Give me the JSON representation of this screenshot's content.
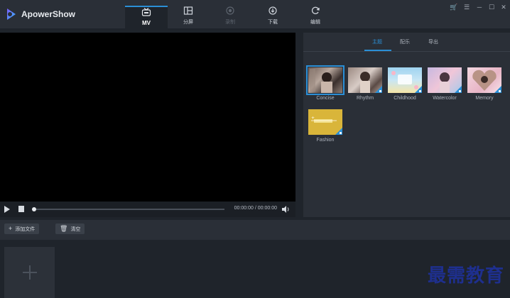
{
  "app": {
    "name": "ApowerShow"
  },
  "nav": [
    {
      "label": "MV",
      "icon": "mv-tv-icon",
      "state": "active"
    },
    {
      "label": "分屏",
      "icon": "split-screen-icon",
      "state": "normal"
    },
    {
      "label": "录制",
      "icon": "record-icon",
      "state": "disabled"
    },
    {
      "label": "下载",
      "icon": "download-icon",
      "state": "normal"
    },
    {
      "label": "编辑",
      "icon": "edit-refresh-icon",
      "state": "normal"
    }
  ],
  "window_controls": [
    "cart-icon",
    "menu-icon",
    "minimize-icon",
    "maximize-icon",
    "close-icon"
  ],
  "player": {
    "time": "00:00:00 / 00:00:00",
    "progress": 0
  },
  "right_panel": {
    "tabs": [
      {
        "label": "主题",
        "active": true
      },
      {
        "label": "配乐",
        "active": false
      },
      {
        "label": "导出",
        "active": false
      }
    ],
    "themes": [
      {
        "label": "Concise",
        "selected": true,
        "downloadable": false
      },
      {
        "label": "Rhythm",
        "selected": false,
        "downloadable": true
      },
      {
        "label": "Childhood",
        "selected": false,
        "downloadable": true
      },
      {
        "label": "Watercolor",
        "selected": false,
        "downloadable": true
      },
      {
        "label": "Memory",
        "selected": false,
        "downloadable": true
      },
      {
        "label": "Fashion",
        "selected": false,
        "downloadable": true
      }
    ]
  },
  "toolbar": {
    "add_file_label": "添加文件",
    "clear_label": "清空"
  },
  "watermark": "最需教育",
  "colors": {
    "accent": "#2b8fd6",
    "background": "#1f242b",
    "panel": "#2a2f37",
    "watermark": "#1e2f8e"
  }
}
